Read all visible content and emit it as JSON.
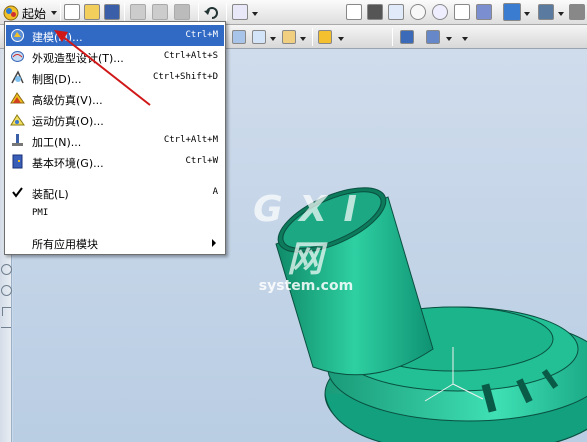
{
  "toolbar": {
    "start_label": "起始"
  },
  "menu": {
    "items": [
      {
        "label": "建模(M)...",
        "shortcut": "Ctrl+M",
        "icon": "modeling-icon"
      },
      {
        "label": "外观造型设计(T)...",
        "shortcut": "Ctrl+Alt+S",
        "icon": "shape-studio-icon"
      },
      {
        "label": "制图(D)...",
        "shortcut": "Ctrl+Shift+D",
        "icon": "drafting-icon"
      },
      {
        "label": "高级仿真(V)...",
        "shortcut": "",
        "icon": "advanced-simulation-icon"
      },
      {
        "label": "运动仿真(O)...",
        "shortcut": "",
        "icon": "motion-simulation-icon"
      },
      {
        "label": "加工(N)...",
        "shortcut": "Ctrl+Alt+M",
        "icon": "manufacturing-icon"
      },
      {
        "label": "基本环境(G)...",
        "shortcut": "Ctrl+W",
        "icon": "gateway-icon"
      }
    ],
    "assembly": {
      "label": "装配(L)",
      "shortcut": "A",
      "checked": true
    },
    "pmi": {
      "label": "PMI"
    },
    "all_apps": {
      "label": "所有应用模块"
    }
  },
  "watermark": {
    "logo": "G X I 网",
    "url": "system.com"
  },
  "colors": {
    "menu_highlight": "#316ac5",
    "model_green": "#1fb890",
    "annotation_red": "#d01818"
  }
}
